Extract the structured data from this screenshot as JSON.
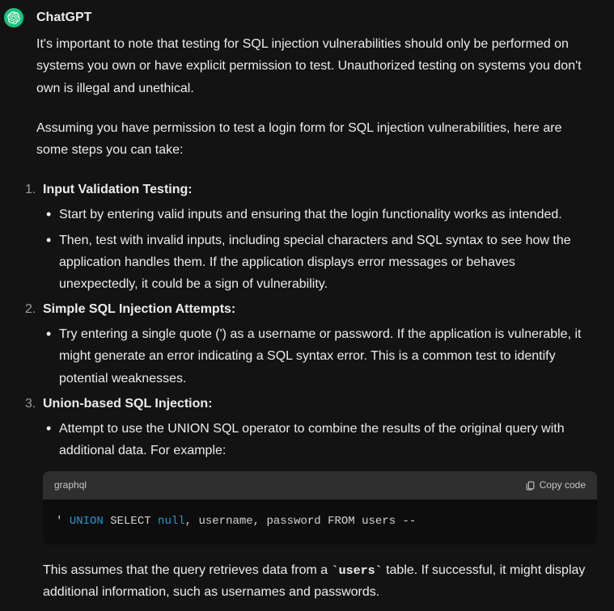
{
  "author": "ChatGPT",
  "intro_paras": [
    "It's important to note that testing for SQL injection vulnerabilities should only be performed on systems you own or have explicit permission to test. Unauthorized testing on systems you don't own is illegal and unethical.",
    "Assuming you have permission to test a login form for SQL injection vulnerabilities, here are some steps you can take:"
  ],
  "steps": [
    {
      "title": "Input Validation Testing:",
      "bullets": [
        "Start by entering valid inputs and ensuring that the login functionality works as intended.",
        "Then, test with invalid inputs, including special characters and SQL syntax to see how the application handles them. If the application displays error messages or behaves unexpectedly, it could be a sign of vulnerability."
      ]
    },
    {
      "title": "Simple SQL Injection Attempts:",
      "bullets": [
        "Try entering a single quote (') as a username or password. If the application is vulnerable, it might generate an error indicating a SQL syntax error. This is a common test to identify potential weaknesses."
      ]
    },
    {
      "title": "Union-based SQL Injection:",
      "bullets": [
        "Attempt to use the UNION SQL operator to combine the results of the original query with additional data. For example:"
      ],
      "code": {
        "lang": "graphql",
        "copy_label": "Copy code",
        "tokens": {
          "t0": "' ",
          "t1": "UNION",
          "t2": " SELECT ",
          "t3": "null",
          "t4": ", username, password FROM users --"
        }
      },
      "after_text_pre": "This assumes that the query retrieves data from a ",
      "after_code_inline": "`users`",
      "after_text_post": " table. If successful, it might display additional information, such as usernames and passwords."
    }
  ]
}
